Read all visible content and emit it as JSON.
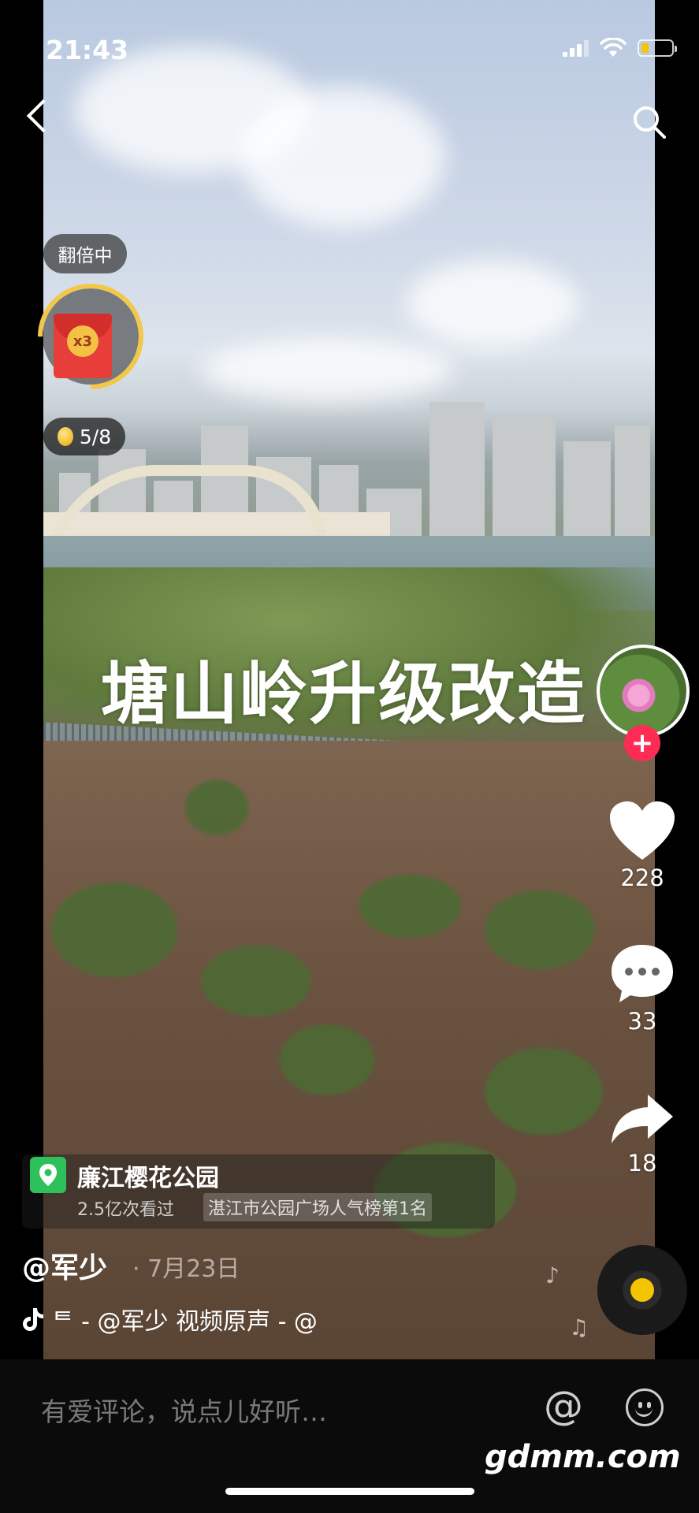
{
  "status_bar": {
    "time": "21:43"
  },
  "reward": {
    "double_badge": "翻倍中",
    "multiplier": "x3",
    "coin_progress": "5/8"
  },
  "video": {
    "overlay_title": "塘山岭升级改造"
  },
  "actions": {
    "likes": "228",
    "comments": "33",
    "shares": "18"
  },
  "location": {
    "name": "廉江樱花公园",
    "views": "2.5亿次看过",
    "rank": "湛江市公园广场人气榜第1名"
  },
  "post": {
    "author": "@军少",
    "date": "· 7月23日",
    "music": "ᄐ - @军少    视频原声 - @"
  },
  "comment_bar": {
    "placeholder": "有爱评论，说点儿好听…"
  },
  "watermark": "gdmm.com"
}
